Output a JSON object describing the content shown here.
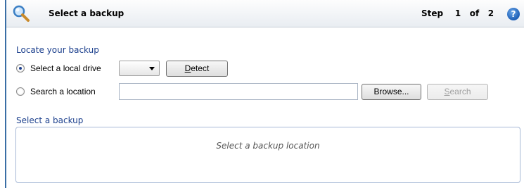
{
  "header": {
    "title": "Select a backup",
    "step_word": "Step",
    "step_current": "1",
    "step_of": "of",
    "step_total": "2",
    "help_glyph": "?"
  },
  "locate": {
    "heading": "Locate your backup",
    "options": [
      {
        "label": "Select a local drive",
        "checked": true
      },
      {
        "label": "Search a location",
        "checked": false
      }
    ],
    "drive_select_value": "",
    "detect_button": {
      "label": "Detect",
      "accel": "D",
      "rest": "etect"
    },
    "search_input_value": "",
    "browse_button": "Browse...",
    "search_button": {
      "label": "Search",
      "accel": "S",
      "rest": "earch",
      "enabled": false
    }
  },
  "backups": {
    "heading": "Select a backup",
    "placeholder": "Select a backup location"
  },
  "colors": {
    "heading": "#1a3e8c",
    "frame_border": "#3a6ea5",
    "list_border": "#a7b9d6"
  }
}
